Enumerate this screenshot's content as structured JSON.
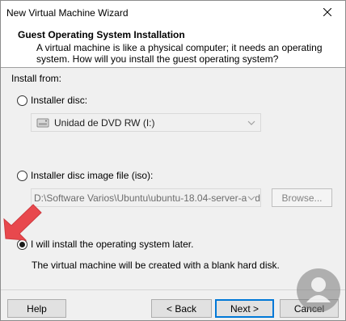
{
  "window": {
    "title": "New Virtual Machine Wizard"
  },
  "header": {
    "title": "Guest Operating System Installation",
    "description": "A virtual machine is like a physical computer; it needs an operating system. How will you install the guest operating system?"
  },
  "install_from": {
    "label": "Install from:",
    "options": [
      {
        "label": "Installer disc:",
        "selected": false,
        "enabled": true
      },
      {
        "label": "Installer disc image file (iso):",
        "selected": false,
        "enabled": true
      },
      {
        "label": "I will install the operating system later.",
        "selected": true,
        "enabled": true
      }
    ],
    "disc_drive": {
      "value": "Unidad de DVD RW (I:)",
      "enabled": false
    },
    "iso_path": {
      "value": "D:\\Software Varios\\Ubuntu\\ubuntu-18.04-server-amd",
      "enabled": false
    },
    "browse_label": "Browse...",
    "later_description": "The virtual machine will be created with a blank hard disk."
  },
  "buttons": {
    "help": "Help",
    "back": "< Back",
    "next": "Next >",
    "cancel": "Cancel"
  },
  "icons": {
    "close": "close-icon",
    "dropdown": "chevron-down-icon",
    "drive": "dvd-drive-icon",
    "annotation": "red-arrow-annotation",
    "watermark": "solvetic-logo"
  },
  "colors": {
    "annotation_red": "#e8484d",
    "focus_blue": "#0078d7",
    "disabled_text": "#6d6d6d"
  }
}
